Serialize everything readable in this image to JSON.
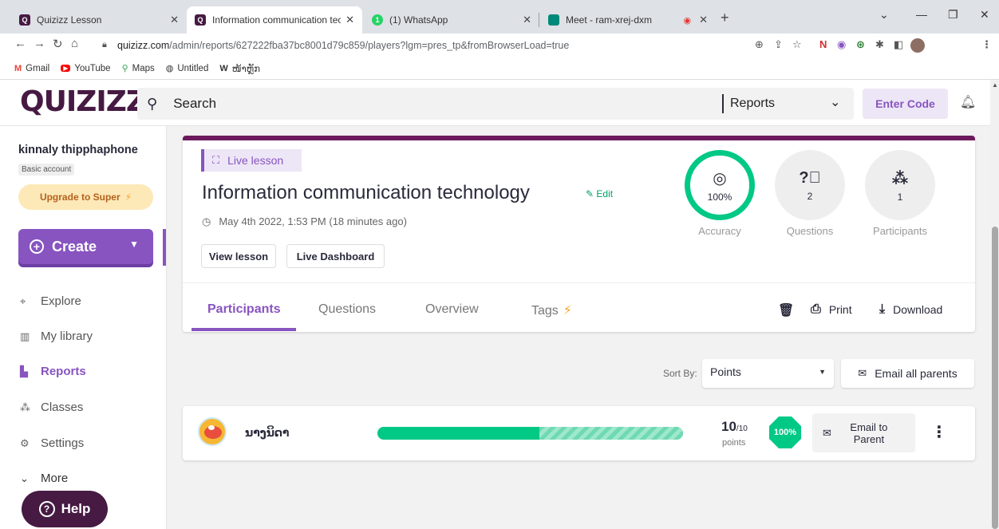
{
  "browser": {
    "tabs": [
      {
        "title": "Quizizz Lesson",
        "favicon": "Q"
      },
      {
        "title": "Information communication tech",
        "favicon": "Q"
      },
      {
        "title": "(1) WhatsApp",
        "favicon": "W"
      },
      {
        "title": "Meet - ram-xrej-dxm",
        "favicon": "M"
      }
    ],
    "url_domain": "quizizz.com",
    "url_path": "/admin/reports/627222fba37bc8001d79c859/players?lgm=pres_tp&fromBrowserLoad=true",
    "bookmarks": [
      "Gmail",
      "YouTube",
      "Maps",
      "Untitled",
      "ໜ້າຫຼັກ"
    ]
  },
  "header": {
    "logo": "QUIZIZZ",
    "search_placeholder": "Search",
    "scope": "Reports",
    "enter_code": "Enter Code"
  },
  "sidebar": {
    "user_name": "kinnaly thipphaphone",
    "account_type": "Basic account",
    "upgrade_label": "Upgrade to Super",
    "create_label": "Create",
    "items": [
      {
        "label": "Explore",
        "icon": "explore-icon"
      },
      {
        "label": "My library",
        "icon": "library-icon"
      },
      {
        "label": "Reports",
        "icon": "reports-icon"
      },
      {
        "label": "Classes",
        "icon": "classes-icon"
      },
      {
        "label": "Settings",
        "icon": "settings-icon"
      },
      {
        "label": "More",
        "icon": "chevron-down-icon"
      }
    ],
    "help_label": "Help"
  },
  "report": {
    "badge": "Live lesson",
    "title": "Information communication technology",
    "edit_label": "Edit",
    "date": "May 4th 2022, 1:53 PM (18 minutes ago)",
    "view_lesson": "View lesson",
    "live_dashboard": "Live Dashboard",
    "stats": {
      "accuracy_value": "100%",
      "accuracy_label": "Accuracy",
      "questions_value": "2",
      "questions_label": "Questions",
      "participants_value": "1",
      "participants_label": "Participants"
    },
    "tabs": [
      "Participants",
      "Questions",
      "Overview",
      "Tags"
    ],
    "print_label": "Print",
    "download_label": "Download"
  },
  "sort": {
    "label": "Sort By:",
    "value": "Points",
    "email_all": "Email all parents"
  },
  "participants": [
    {
      "name": "ນາງນິດາ",
      "score": "10",
      "score_total": "/10",
      "points_label": "points",
      "accuracy": "100%",
      "correct_fraction": 0.53,
      "email_label": "Email to Parent"
    }
  ],
  "colors": {
    "brand": "#461a42",
    "accent": "#8854c0",
    "success": "#00c985"
  }
}
